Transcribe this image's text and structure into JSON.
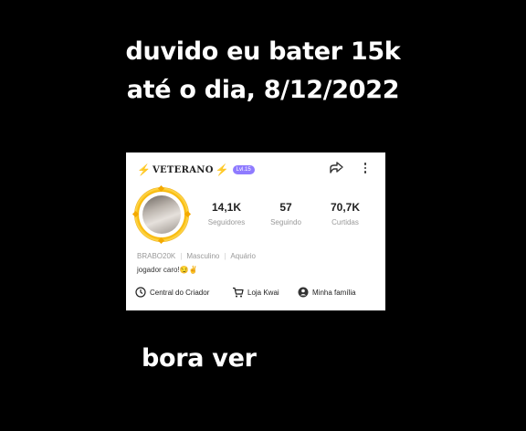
{
  "captions": {
    "line1": "duvido eu bater 15k",
    "line2": "até o dia, 8/12/2022",
    "bottom": "bora ver"
  },
  "profile": {
    "title": "VETERANO",
    "badge": "Lvl.15",
    "stats": [
      {
        "value": "14,1K",
        "label": "Seguidores"
      },
      {
        "value": "57",
        "label": "Seguindo"
      },
      {
        "value": "70,7K",
        "label": "Curtidas"
      }
    ],
    "meta": {
      "username": "BRABO20K",
      "gender": "Masculino",
      "sign": "Aquário"
    },
    "bio": "jogador caro!😏✌",
    "actions": [
      {
        "label": "Central do Criador",
        "icon": "creator-center-icon"
      },
      {
        "label": "Loja Kwai",
        "icon": "cart-icon"
      },
      {
        "label": "Minha família",
        "icon": "family-icon"
      }
    ]
  },
  "colors": {
    "background": "#000000",
    "accent": "#f4b400",
    "badge": "#8f7bff"
  }
}
